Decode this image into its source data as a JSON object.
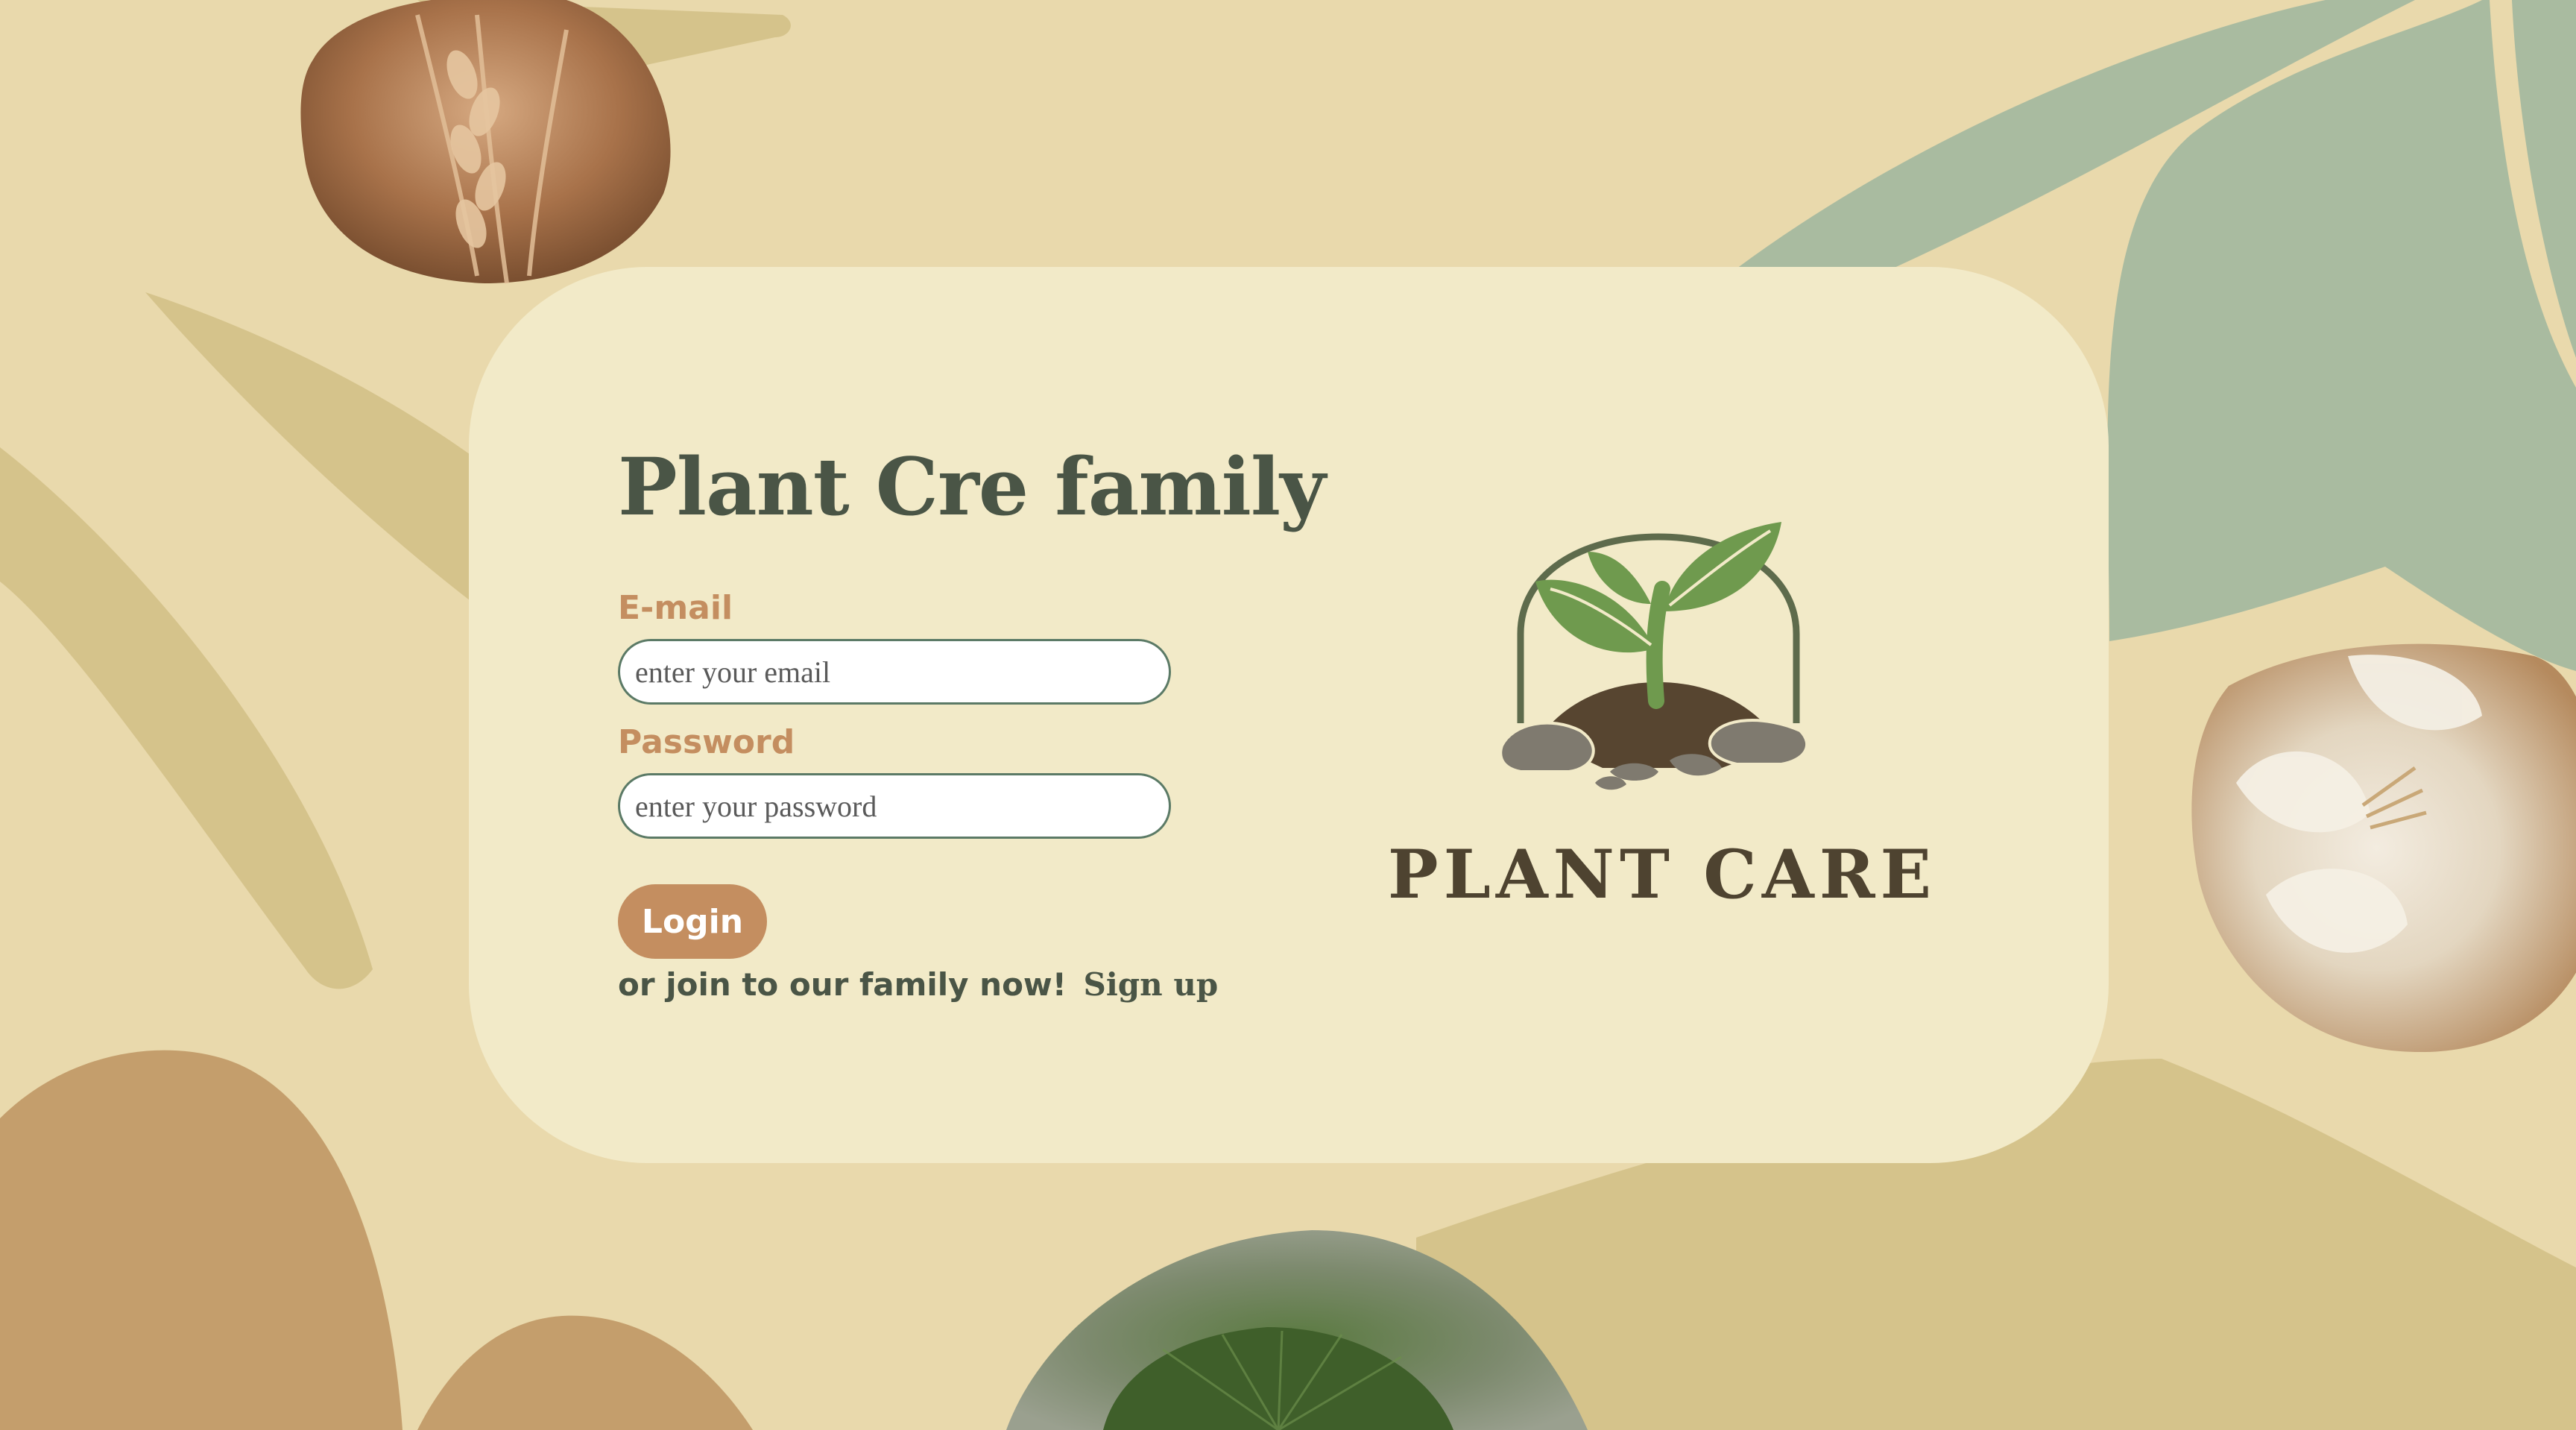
{
  "colors": {
    "background": "#e9d9ac",
    "card": "#f2eac8",
    "title": "#4a5546",
    "label": "#c48e60",
    "button": "#c48e60",
    "field_border": "#5b7a66",
    "logo_text": "#4e4330",
    "sage": "#a9bba0",
    "olive": "#d5c38b",
    "tan": "#c49e6c"
  },
  "login": {
    "title": "Plant Cre family",
    "email_label": "E-mail",
    "email_placeholder": "enter your email",
    "password_label": "Password",
    "password_placeholder": "enter your password",
    "login_button": "Login",
    "signup_prompt": "or join to our family now!",
    "signup_link": "Sign up"
  },
  "logo": {
    "text": "PLANT CARE",
    "icon": "sprout-in-soil-icon"
  },
  "decorations": [
    "wheat-photo",
    "magnolia-flower-photo",
    "ginkgo-leaf-photo"
  ]
}
